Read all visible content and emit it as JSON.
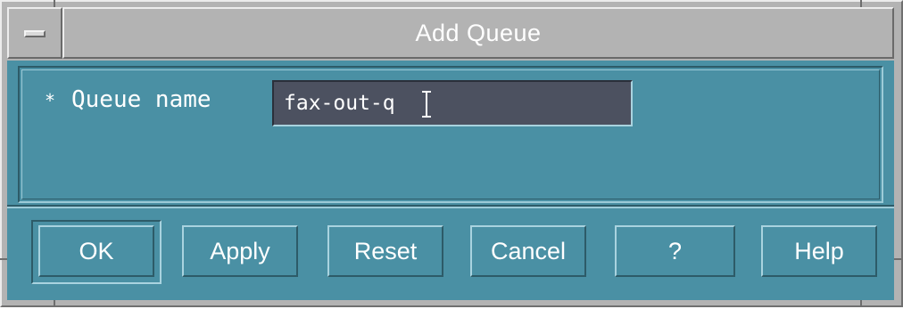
{
  "window": {
    "title": "Add Queue",
    "menu_button": "window-menu"
  },
  "form": {
    "required_marker": "*",
    "queue_name_label": "Queue name",
    "queue_name_value": "fax-out-q"
  },
  "buttons": {
    "ok": "OK",
    "apply": "Apply",
    "reset": "Reset",
    "cancel": "Cancel",
    "question": "?",
    "help": "Help"
  },
  "colors": {
    "dialog_background": "#4a90a4",
    "frame": "#b3b3b3",
    "input_background": "#4c5160",
    "text": "#ffffff"
  },
  "icons": {
    "window_menu": "window-menu-icon",
    "text_cursor": "i-beam-cursor-icon"
  }
}
